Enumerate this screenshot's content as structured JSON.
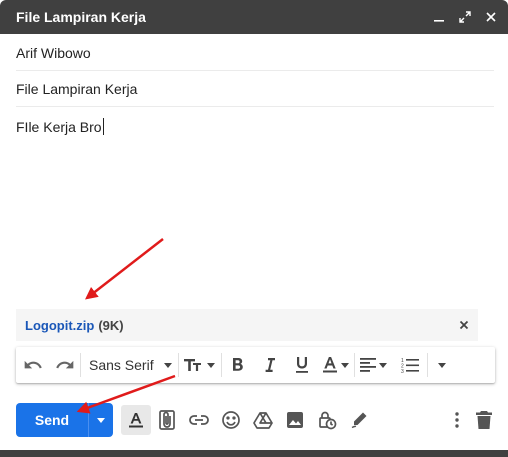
{
  "window": {
    "title": "File Lampiran Kerja"
  },
  "compose": {
    "recipient": "Arif Wibowo",
    "subject": "File Lampiran Kerja",
    "body": "FIle Kerja Bro"
  },
  "attachment": {
    "name": "Logopit.zip",
    "size": "(9K)"
  },
  "format_toolbar": {
    "font": "Sans Serif"
  },
  "actions": {
    "send_label": "Send"
  },
  "colors": {
    "titlebar": "#404040",
    "send_button": "#1a73e8",
    "attachment_link": "#1a57b8",
    "annotation_arrow": "#e01b1b"
  },
  "icons": [
    "minimize-icon",
    "expand-icon",
    "close-icon",
    "remove-attachment-icon",
    "undo-icon",
    "redo-icon",
    "font-size-icon",
    "bold-icon",
    "italic-icon",
    "underline-icon",
    "text-color-icon",
    "align-icon",
    "numbered-list-icon",
    "more-formatting-icon",
    "formatting-options-icon",
    "attach-file-icon",
    "insert-link-icon",
    "emoji-icon",
    "google-drive-icon",
    "insert-photo-icon",
    "confidential-mode-icon",
    "signature-icon",
    "more-options-icon",
    "discard-draft-icon"
  ]
}
